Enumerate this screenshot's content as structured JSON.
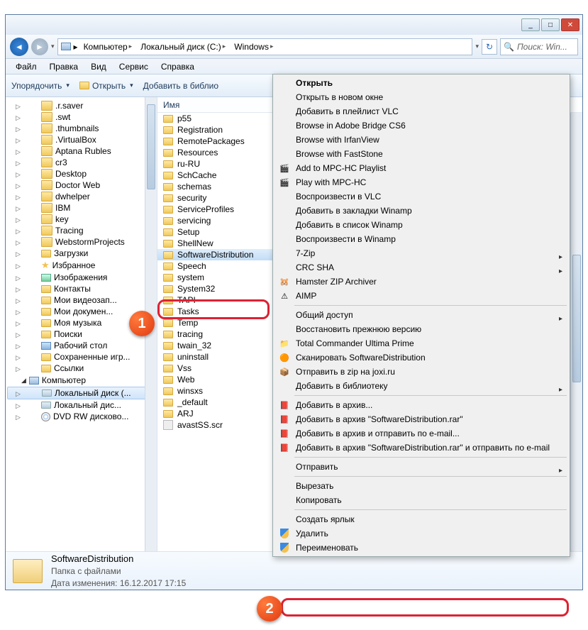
{
  "window": {
    "min": "_",
    "max": "□",
    "close": "✕"
  },
  "nav": {
    "crumbs": [
      "Компьютер",
      "Локальный диск (C:)",
      "Windows"
    ],
    "search_placeholder": "Поиск: Win..."
  },
  "menubar": [
    "Файл",
    "Правка",
    "Вид",
    "Сервис",
    "Справка"
  ],
  "toolbar": {
    "organize": "Упорядочить",
    "open": "Открыть",
    "addlib": "Добавить в библио"
  },
  "tree": {
    "folders": [
      ".r.saver",
      ".swt",
      ".thumbnails",
      ".VirtualBox",
      "Aptana Rubles",
      "cr3",
      "Desktop",
      "Doctor Web",
      "dwhelper",
      "IBM",
      "key",
      "Tracing",
      "WebstormProjects"
    ],
    "special": [
      {
        "icon": "folder",
        "label": "Загрузки"
      },
      {
        "icon": "star",
        "label": "Избранное"
      },
      {
        "icon": "img",
        "label": "Изображения"
      },
      {
        "icon": "folder",
        "label": "Контакты"
      },
      {
        "icon": "folder",
        "label": "Мои видеозап..."
      },
      {
        "icon": "folder",
        "label": "Мои докумен..."
      },
      {
        "icon": "folder",
        "label": "Моя музыка"
      },
      {
        "icon": "folder",
        "label": "Поиски"
      },
      {
        "icon": "lib",
        "label": "Рабочий стол"
      },
      {
        "icon": "folder",
        "label": "Сохраненные игр..."
      },
      {
        "icon": "folder",
        "label": "Ссылки"
      }
    ],
    "computer": "Компьютер",
    "drives": [
      {
        "icon": "disk",
        "label": "Локальный диск (..."
      },
      {
        "icon": "disk",
        "label": "Локальный дис..."
      },
      {
        "icon": "dvd",
        "label": "DVD RW дисково..."
      }
    ]
  },
  "list": {
    "header": "Имя",
    "items": [
      "p55",
      "Registration",
      "RemotePackages",
      "Resources",
      "ru-RU",
      "SchCache",
      "schemas",
      "security",
      "ServiceProfiles",
      "servicing",
      "Setup",
      "ShellNew",
      "SoftwareDistribution",
      "Speech",
      "system",
      "System32",
      "TAPI",
      "Tasks",
      "Temp",
      "tracing",
      "twain_32",
      "uninstall",
      "Vss",
      "Web",
      "winsxs",
      "_default",
      "ARJ",
      "avastSS.scr"
    ],
    "selected": "SoftwareDistribution"
  },
  "context": {
    "g1": [
      "Открыть",
      "Открыть в новом окне",
      "Добавить в плейлист VLC",
      "Browse in Adobe Bridge CS6",
      "Browse with IrfanView",
      "Browse with FastStone",
      "Add to MPC-HC Playlist",
      "Play with MPC-HC",
      "Воспроизвести в VLC",
      "Добавить в закладки Winamp",
      "Добавить в список Winamp",
      "Воспроизвести в Winamp",
      "7-Zip",
      "CRC SHA",
      "Hamster ZIP Archiver",
      "AIMP"
    ],
    "g2": [
      "Общий доступ",
      "Восстановить прежнюю версию",
      "Total Commander Ultima Prime",
      "Сканировать SoftwareDistribution",
      "Отправить в zip на joxi.ru",
      "Добавить в библиотеку"
    ],
    "g3": [
      "Добавить в архив...",
      "Добавить в архив \"SoftwareDistribution.rar\"",
      "Добавить в архив и отправить по e-mail...",
      "Добавить в архив \"SoftwareDistribution.rar\" и отправить по e-mail"
    ],
    "g4": [
      "Отправить"
    ],
    "g5": [
      "Вырезать",
      "Копировать"
    ],
    "g6": [
      "Создать ярлык",
      "Удалить",
      "Переименовать"
    ]
  },
  "details": {
    "name": "SoftwareDistribution",
    "type": "Папка с файлами",
    "mod_label": "Дата изменения:",
    "mod_value": "16.12.2017 17:15"
  },
  "badges": {
    "b1": "1",
    "b2": "2"
  }
}
